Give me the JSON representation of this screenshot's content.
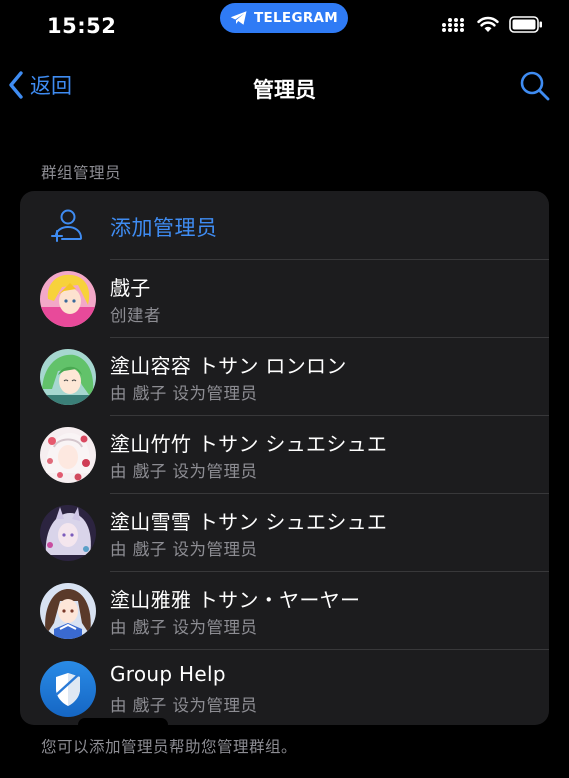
{
  "status": {
    "time": "15:52",
    "telegram_label": "TELEGRAM"
  },
  "nav": {
    "back_label": "返回",
    "title": "管理员"
  },
  "section_header": "群组管理员",
  "add_admin_label": "添加管理员",
  "admins": [
    {
      "name": "戲子",
      "role": "创建者",
      "avatar": "avatar-anime-pink"
    },
    {
      "name": "塗山容容 トサン ロンロン",
      "role": "由 戲子 设为管理员",
      "avatar": "avatar-anime-green"
    },
    {
      "name": "塗山竹竹 トサン シュエシュエ",
      "role": "由 戲子 设为管理员",
      "avatar": "avatar-anime-white"
    },
    {
      "name": "塗山雪雪 トサン シュエシュエ",
      "role": "由 戲子 设为管理员",
      "avatar": "avatar-anime-purple"
    },
    {
      "name": "塗山雅雅 トサン・ヤーヤー",
      "role": "由 戲子 设为管理员",
      "avatar": "avatar-anime-brown"
    },
    {
      "name": "Group Help",
      "role": "由 戲子 设为管理员",
      "avatar": "shield-icon"
    }
  ],
  "footer_note": "您可以添加管理员帮助您管理群组。",
  "colors": {
    "accent": "#3f8cf2",
    "background": "#000000",
    "card": "#1c1c1e",
    "secondary_text": "#8d8d93",
    "telegram_pill": "#2f7bf5"
  }
}
